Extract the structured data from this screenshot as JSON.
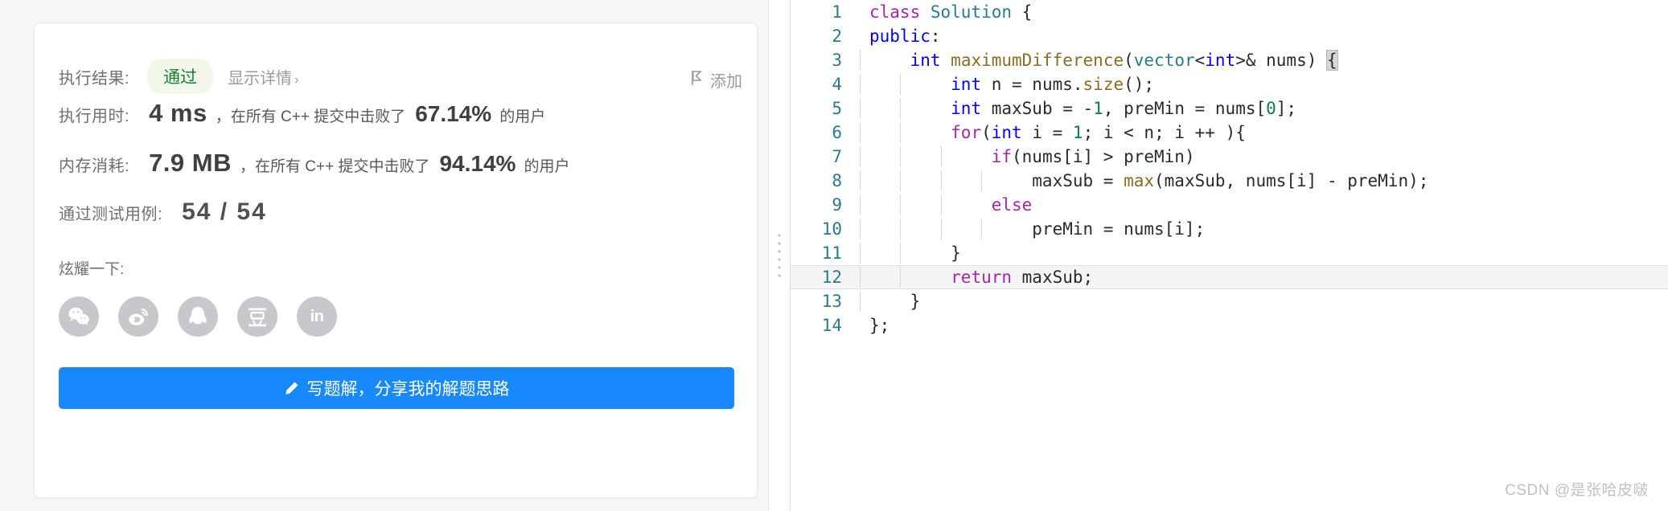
{
  "left_panel": {
    "result_row": {
      "label": "执行结果:",
      "status": "通过",
      "detail_link": "显示详情",
      "chevron": "›",
      "status_bg": "#f2f8e9",
      "status_color": "#1a7f37"
    },
    "runtime_row": {
      "label": "执行用时:",
      "value": "4 ms",
      "middle": "，在所有 C++ 提交中击败了",
      "percent": "67.14%",
      "tail": "的用户"
    },
    "memory_row": {
      "label": "内存消耗:",
      "value": "7.9 MB",
      "middle": "，在所有 C++ 提交中击败了",
      "percent": "94.14%",
      "tail": "的用户"
    },
    "testcases_row": {
      "label": "通过测试用例:",
      "value": "54 / 54"
    },
    "share_row": {
      "label": "炫耀一下:"
    },
    "social_buttons": [
      {
        "name": "wechat-icon",
        "title": "微信"
      },
      {
        "name": "weibo-icon",
        "title": "微博"
      },
      {
        "name": "qq-icon",
        "title": "QQ"
      },
      {
        "name": "douban-icon",
        "title": "豆瓣"
      },
      {
        "name": "linkedin-icon",
        "title": "in"
      }
    ],
    "solution_button": {
      "label": "写题解，分享我的解题思路",
      "icon": "pencil-icon",
      "color": "#1789fc"
    },
    "add_note": {
      "label": "添加",
      "icon": "flag-icon"
    }
  },
  "code_panel": {
    "language": "cpp",
    "active_line": 12,
    "watermark": "CSDN @是张哈皮啵",
    "lines": [
      {
        "n": "1",
        "tokens": [
          {
            "t": "class ",
            "c": "kc"
          },
          {
            "t": "Solution",
            "c": "cls"
          },
          {
            "t": " {",
            "c": "pl"
          }
        ],
        "indent": 0
      },
      {
        "n": "2",
        "tokens": [
          {
            "t": "public",
            "c": "k"
          },
          {
            "t": ":",
            "c": "pl"
          }
        ],
        "indent": 0
      },
      {
        "n": "3",
        "tokens": [
          {
            "t": "    ",
            "c": "pl"
          },
          {
            "t": "int",
            "c": "k"
          },
          {
            "t": " ",
            "c": "pl"
          },
          {
            "t": "maximumDifference",
            "c": "fn"
          },
          {
            "t": "(",
            "c": "pl"
          },
          {
            "t": "vector",
            "c": "cls"
          },
          {
            "t": "<",
            "c": "pl"
          },
          {
            "t": "int",
            "c": "k"
          },
          {
            "t": ">& nums) ",
            "c": "pl"
          },
          {
            "t": "{",
            "c": "brace"
          }
        ],
        "indent": 1
      },
      {
        "n": "4",
        "tokens": [
          {
            "t": "        ",
            "c": "pl"
          },
          {
            "t": "int",
            "c": "k"
          },
          {
            "t": " n = nums.",
            "c": "pl"
          },
          {
            "t": "size",
            "c": "fn"
          },
          {
            "t": "();",
            "c": "pl"
          }
        ],
        "indent": 2
      },
      {
        "n": "5",
        "tokens": [
          {
            "t": "        ",
            "c": "pl"
          },
          {
            "t": "int",
            "c": "k"
          },
          {
            "t": " maxSub = -",
            "c": "pl"
          },
          {
            "t": "1",
            "c": "num"
          },
          {
            "t": ", preMin = nums[",
            "c": "pl"
          },
          {
            "t": "0",
            "c": "num"
          },
          {
            "t": "];",
            "c": "pl"
          }
        ],
        "indent": 2
      },
      {
        "n": "6",
        "tokens": [
          {
            "t": "        ",
            "c": "pl"
          },
          {
            "t": "for",
            "c": "kc"
          },
          {
            "t": "(",
            "c": "pl"
          },
          {
            "t": "int",
            "c": "k"
          },
          {
            "t": " i = ",
            "c": "pl"
          },
          {
            "t": "1",
            "c": "num"
          },
          {
            "t": "; i < n; i ++ ){",
            "c": "pl"
          }
        ],
        "indent": 2
      },
      {
        "n": "7",
        "tokens": [
          {
            "t": "            ",
            "c": "pl"
          },
          {
            "t": "if",
            "c": "kc"
          },
          {
            "t": "(nums[i] > preMin)",
            "c": "pl"
          }
        ],
        "indent": 3
      },
      {
        "n": "8",
        "tokens": [
          {
            "t": "                maxSub = ",
            "c": "pl"
          },
          {
            "t": "max",
            "c": "fn"
          },
          {
            "t": "(maxSub, nums[i] - preMin);",
            "c": "pl"
          }
        ],
        "indent": 4
      },
      {
        "n": "9",
        "tokens": [
          {
            "t": "            ",
            "c": "pl"
          },
          {
            "t": "else",
            "c": "kc"
          }
        ],
        "indent": 3
      },
      {
        "n": "10",
        "tokens": [
          {
            "t": "                preMin = nums[i];",
            "c": "pl"
          }
        ],
        "indent": 4
      },
      {
        "n": "11",
        "tokens": [
          {
            "t": "        }",
            "c": "pl"
          }
        ],
        "indent": 2
      },
      {
        "n": "12",
        "tokens": [
          {
            "t": "        ",
            "c": "pl"
          },
          {
            "t": "return",
            "c": "kc"
          },
          {
            "t": " maxSub;",
            "c": "pl"
          }
        ],
        "indent": 2
      },
      {
        "n": "13",
        "tokens": [
          {
            "t": "    }",
            "c": "pl"
          }
        ],
        "indent": 1
      },
      {
        "n": "14",
        "tokens": [
          {
            "t": "};",
            "c": "pl"
          }
        ],
        "indent": 0
      }
    ]
  }
}
